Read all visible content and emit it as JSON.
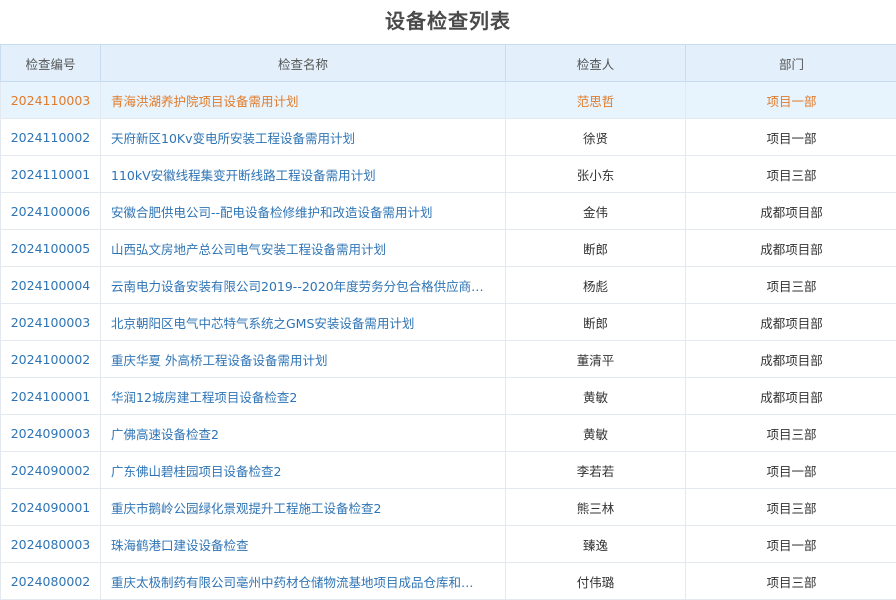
{
  "title": "设备检查列表",
  "columns": {
    "code": "检查编号",
    "name": "检查名称",
    "person": "检查人",
    "dept": "部门"
  },
  "rows": [
    {
      "code": "2024110003",
      "name": "青海洪湖养护院项目设备需用计划",
      "person": "范思哲",
      "dept": "项目一部"
    },
    {
      "code": "2024110002",
      "name": "天府新区10Kv变电所安装工程设备需用计划",
      "person": "徐贤",
      "dept": "项目一部"
    },
    {
      "code": "2024110001",
      "name": "110kV安徽线程集变开断线路工程设备需用计划",
      "person": "张小东",
      "dept": "项目三部"
    },
    {
      "code": "2024100006",
      "name": "安徽合肥供电公司--配电设备检修维护和改造设备需用计划",
      "person": "金伟",
      "dept": "成都项目部"
    },
    {
      "code": "2024100005",
      "name": "山西弘文房地产总公司电气安装工程设备需用计划",
      "person": "断郎",
      "dept": "成都项目部"
    },
    {
      "code": "2024100004",
      "name": "云南电力设备安装有限公司2019--2020年度劳务分包合格供应商…",
      "person": "杨彪",
      "dept": "项目三部"
    },
    {
      "code": "2024100003",
      "name": "北京朝阳区电气中芯特气系统之GMS安装设备需用计划",
      "person": "断郎",
      "dept": "成都项目部"
    },
    {
      "code": "2024100002",
      "name": "重庆华夏 外高桥工程设备设备需用计划",
      "person": "董清平",
      "dept": "成都项目部"
    },
    {
      "code": "2024100001",
      "name": "华润12城房建工程项目设备检查2",
      "person": "黄敏",
      "dept": "成都项目部"
    },
    {
      "code": "2024090003",
      "name": "广佛高速设备检查2",
      "person": "黄敏",
      "dept": "项目三部"
    },
    {
      "code": "2024090002",
      "name": "广东佛山碧桂园项目设备检查2",
      "person": "李若若",
      "dept": "项目一部"
    },
    {
      "code": "2024090001",
      "name": "重庆市鹅岭公园绿化景观提升工程施工设备检查2",
      "person": "熊三林",
      "dept": "项目三部"
    },
    {
      "code": "2024080003",
      "name": "珠海鹤港口建设设备检查",
      "person": "臻逸",
      "dept": "项目一部"
    },
    {
      "code": "2024080002",
      "name": "重庆太极制药有限公司亳州中药材仓储物流基地项目成品仓库和…",
      "person": "付伟璐",
      "dept": "项目三部"
    }
  ],
  "selected_row": 0,
  "colors": {
    "link": "#2e74b5",
    "selected_text": "#e07b2a",
    "header_bg": "#e3f0fb",
    "selected_bg": "#e8f4fd"
  }
}
